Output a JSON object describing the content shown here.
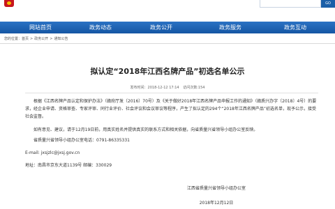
{
  "header": {
    "search_button": "GO"
  },
  "nav": {
    "items": [
      "网站首页",
      "政务动态",
      "政务公开",
      "政务服务",
      "政务互动"
    ]
  },
  "breadcrumb": {
    "prefix": "您的位置：",
    "items": [
      "首页",
      "政务公开",
      "通知公告"
    ],
    "separator": ">"
  },
  "article": {
    "title": "拟认定“2018年江西名牌产品”初选名单公示",
    "publish_time": "发布时间：2018-12-12 17:14",
    "views": "访问次数:154",
    "para1": "根据《江西名牌产品认定和保护办法》（赣府厅发〔2016〕70号）及《关于做好2018年江西名牌产品申报工作的通知》（赣质兴办字〔2018〕4号）的要求，经企业申请、资格审查、专家评审、同行业评价、社会评议和会议审议等程序，产生了拟认定的294个“2018年江西名牌产品”初选名单，现予公示，接受社会监督。",
    "para2": "如有意见、建议，请于12月19日前，用真实姓名并提供真实的联系方式和相关依据，向省质量兴省领导小组办公室反映。",
    "phone": "省质量兴省领导小组办公室电话：0791-86335331",
    "email": "E-mail: jxsjzlc@jxsj.gov.cn",
    "address": "地址：南昌市京东大道1139号    邮编：330029",
    "signature_org": "江西省质量兴省领导小组办公室",
    "signature_date": "2018年12月12日"
  }
}
